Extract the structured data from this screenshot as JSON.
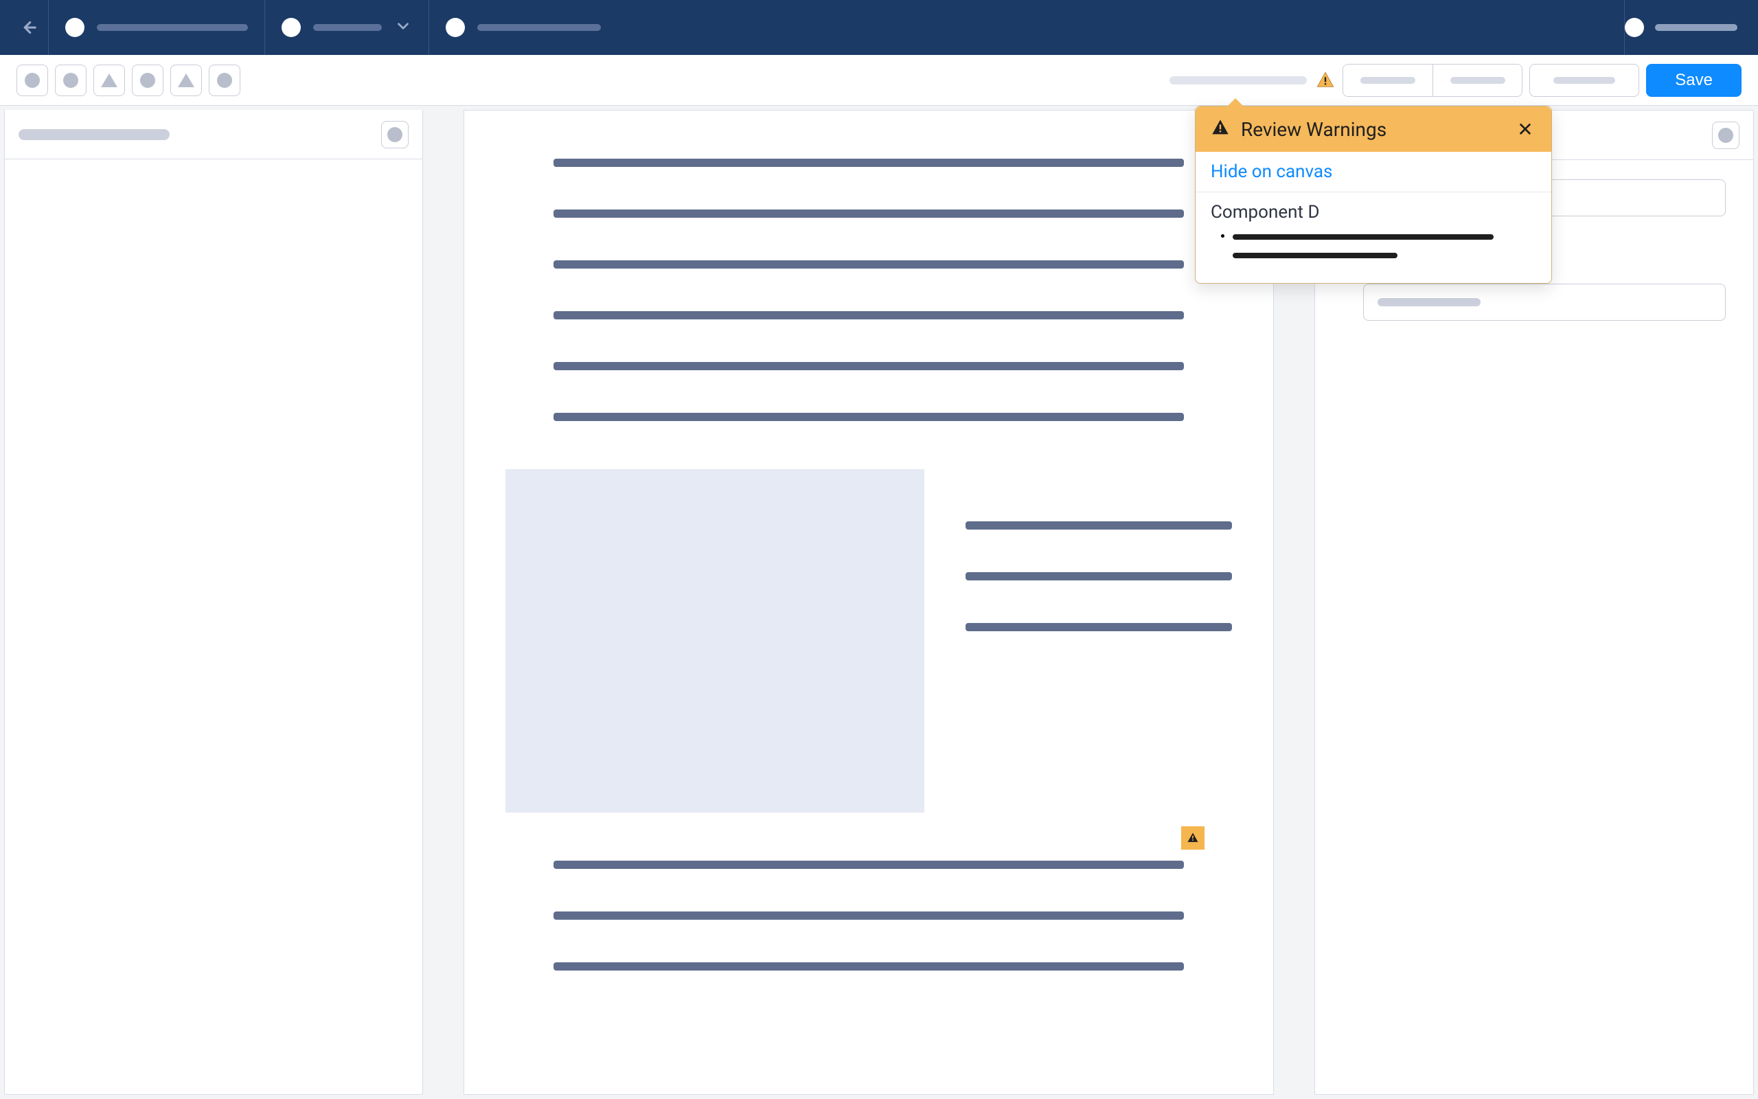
{
  "toolbar": {
    "save_label": "Save"
  },
  "popover": {
    "title": "Review Warnings",
    "action": "Hide on canvas",
    "section": "Component D"
  },
  "colors": {
    "primary": "#0D8BFF",
    "warning": "#F6B95B",
    "navBg": "#1B3A66"
  }
}
